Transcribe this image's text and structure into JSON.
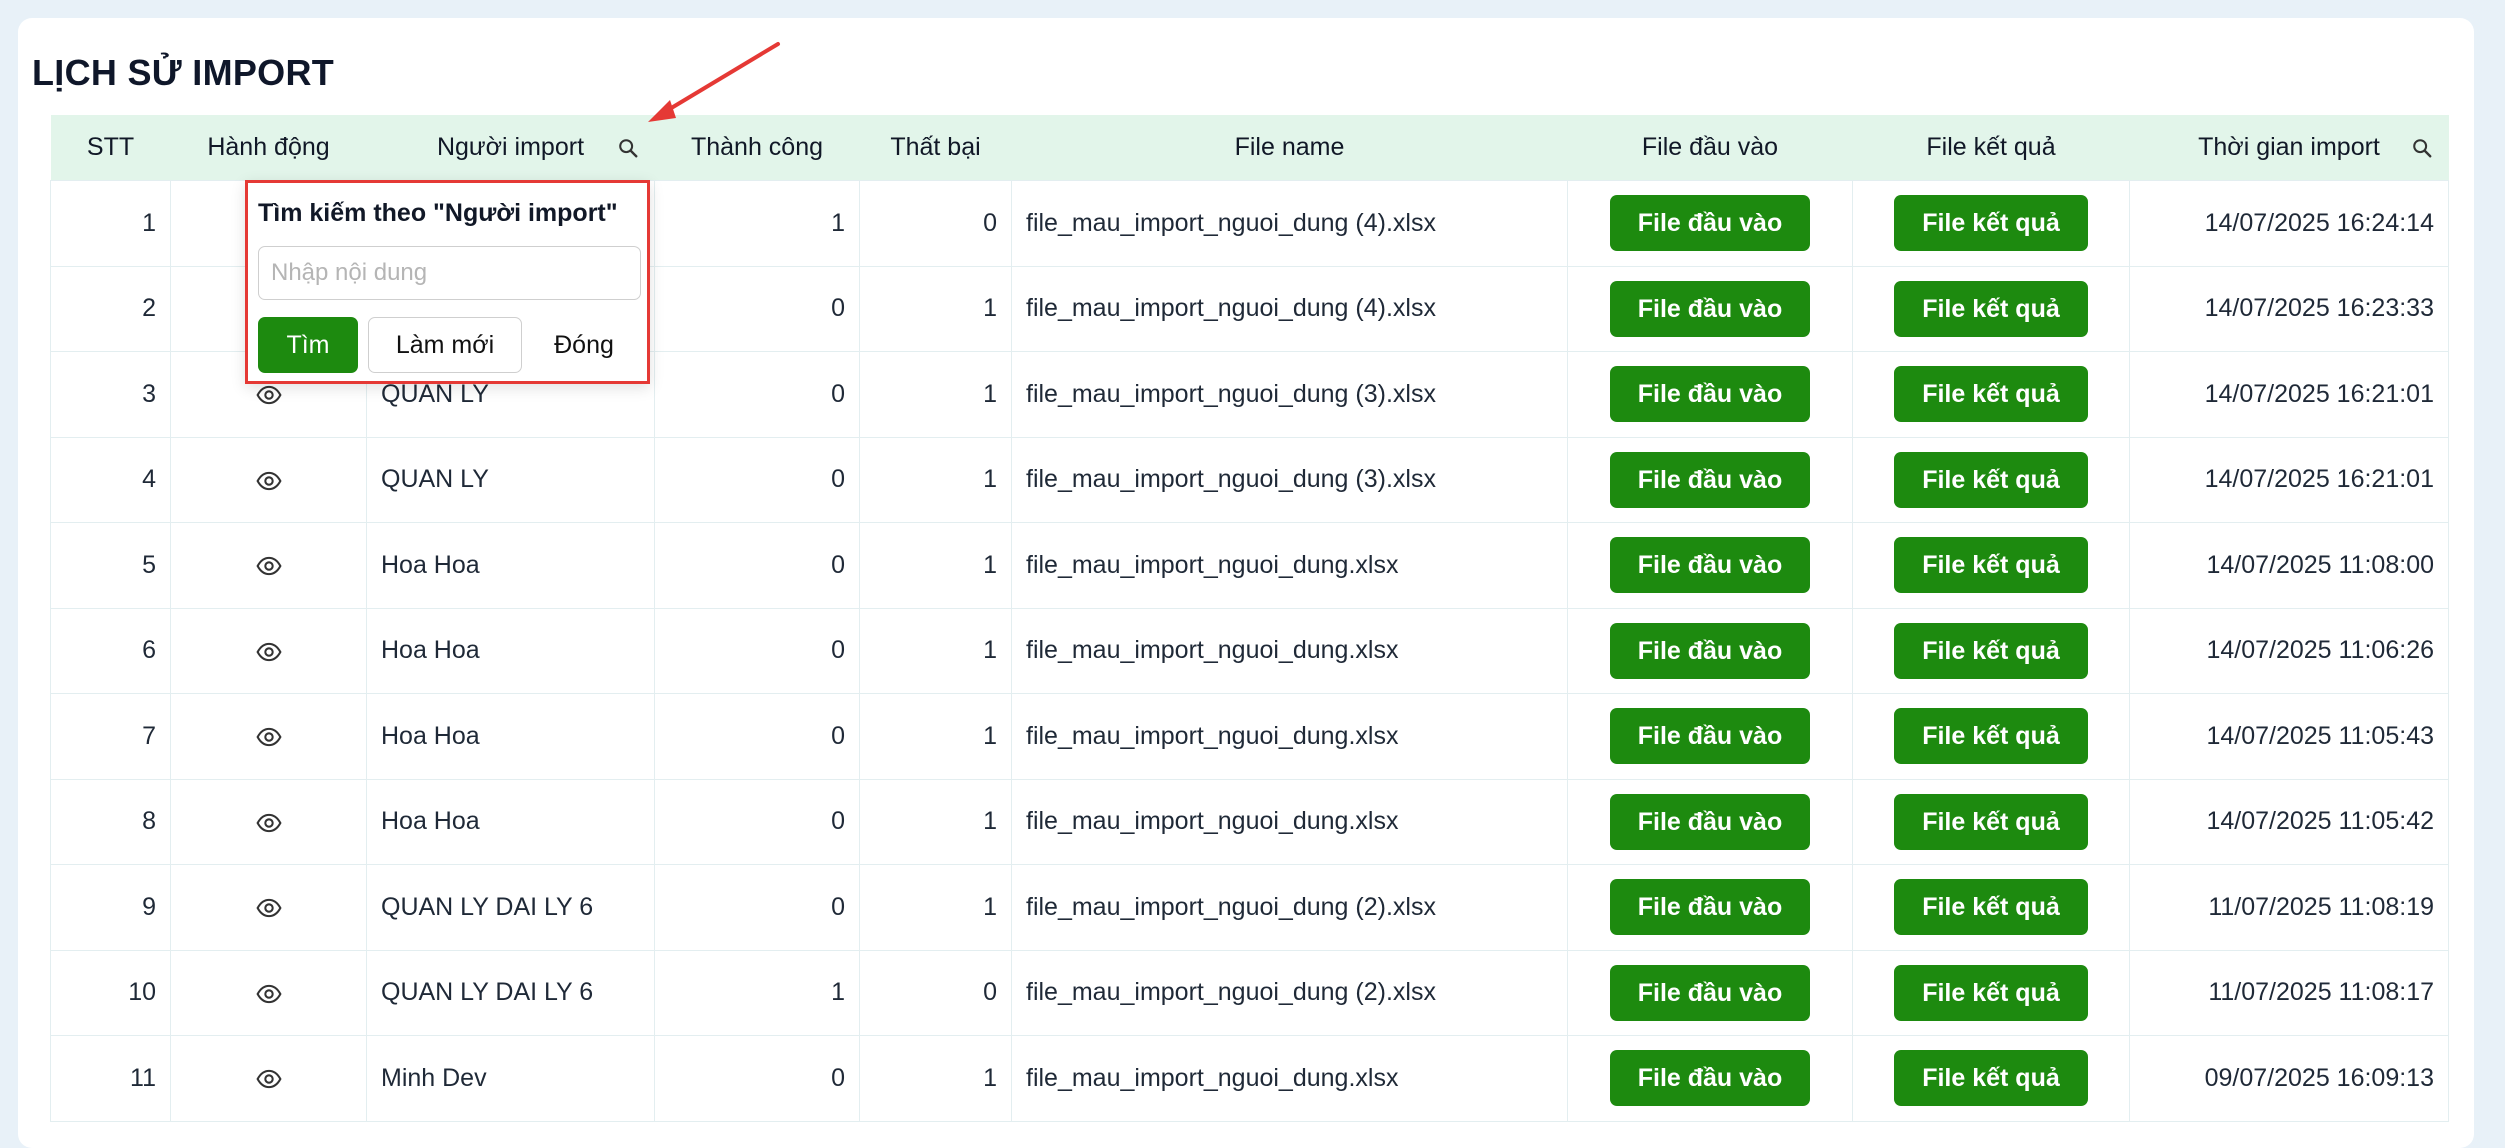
{
  "page": {
    "title": "LỊCH SỬ IMPORT"
  },
  "table": {
    "columns": [
      "STT",
      "Hành động",
      "Người import",
      "Thành công",
      "Thất bại",
      "File name",
      "File đầu vào",
      "File kết quả",
      "Thời gian import"
    ],
    "rows": [
      {
        "stt": "1",
        "user": "",
        "success": "1",
        "fail": "0",
        "file": "file_mau_import_nguoi_dung (4).xlsx",
        "time": "14/07/2025 16:24:14"
      },
      {
        "stt": "2",
        "user": "",
        "success": "0",
        "fail": "1",
        "file": "file_mau_import_nguoi_dung (4).xlsx",
        "time": "14/07/2025 16:23:33"
      },
      {
        "stt": "3",
        "user": "QUAN LY",
        "success": "0",
        "fail": "1",
        "file": "file_mau_import_nguoi_dung (3).xlsx",
        "time": "14/07/2025 16:21:01"
      },
      {
        "stt": "4",
        "user": "QUAN LY",
        "success": "0",
        "fail": "1",
        "file": "file_mau_import_nguoi_dung (3).xlsx",
        "time": "14/07/2025 16:21:01"
      },
      {
        "stt": "5",
        "user": "Hoa Hoa",
        "success": "0",
        "fail": "1",
        "file": "file_mau_import_nguoi_dung.xlsx",
        "time": "14/07/2025 11:08:00"
      },
      {
        "stt": "6",
        "user": "Hoa Hoa",
        "success": "0",
        "fail": "1",
        "file": "file_mau_import_nguoi_dung.xlsx",
        "time": "14/07/2025 11:06:26"
      },
      {
        "stt": "7",
        "user": "Hoa Hoa",
        "success": "0",
        "fail": "1",
        "file": "file_mau_import_nguoi_dung.xlsx",
        "time": "14/07/2025 11:05:43"
      },
      {
        "stt": "8",
        "user": "Hoa Hoa",
        "success": "0",
        "fail": "1",
        "file": "file_mau_import_nguoi_dung.xlsx",
        "time": "14/07/2025 11:05:42"
      },
      {
        "stt": "9",
        "user": "QUAN LY DAI LY 6",
        "success": "0",
        "fail": "1",
        "file": "file_mau_import_nguoi_dung (2).xlsx",
        "time": "11/07/2025 11:08:19"
      },
      {
        "stt": "10",
        "user": "QUAN LY DAI LY 6",
        "success": "1",
        "fail": "0",
        "file": "file_mau_import_nguoi_dung (2).xlsx",
        "time": "11/07/2025 11:08:17"
      },
      {
        "stt": "11",
        "user": "Minh Dev",
        "success": "0",
        "fail": "1",
        "file": "file_mau_import_nguoi_dung.xlsx",
        "time": "09/07/2025 16:09:13"
      }
    ],
    "input_file_label": "File đầu vào",
    "result_file_label": "File kết quả"
  },
  "search_popup": {
    "title": "Tìm kiếm theo \"Người import\"",
    "placeholder": "Nhập nội dung",
    "value": "",
    "search_label": "Tìm",
    "reset_label": "Làm mới",
    "close_label": "Đóng"
  },
  "colors": {
    "accent_green": "#1d8a0f",
    "header_bg": "#e2f5ea",
    "highlight_red": "#e53935",
    "page_bg": "#e8f1f8"
  },
  "icons": {
    "search": "search-icon",
    "view": "eye-icon",
    "annotation": "red-arrow"
  }
}
